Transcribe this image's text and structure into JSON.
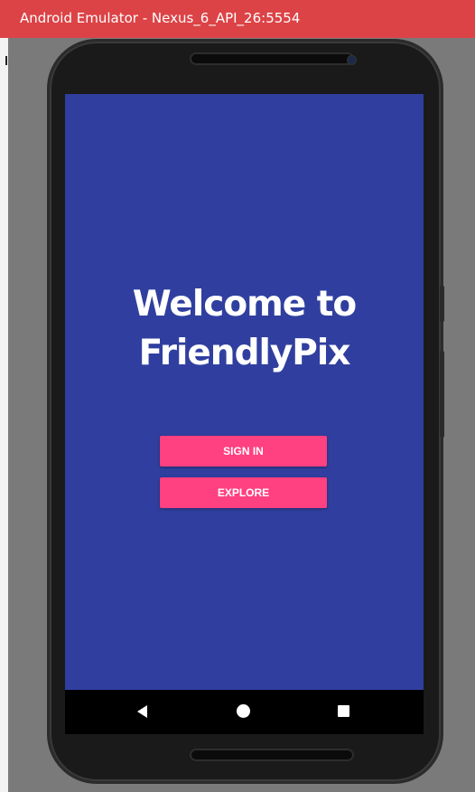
{
  "window": {
    "title": "Android Emulator - Nexus_6_API_26:5554"
  },
  "app": {
    "welcome_line1": "Welcome to",
    "welcome_line2": "FriendlyPix",
    "sign_in_label": "SIGN IN",
    "explore_label": "EXPLORE"
  },
  "navigation_bar": {
    "back_icon": "triangle-back-icon",
    "home_icon": "circle-home-icon",
    "recents_icon": "square-recents-icon"
  },
  "colors": {
    "title_bar": "#dc4346",
    "screen_background": "#303f9f",
    "button_accent": "#ff4081"
  }
}
